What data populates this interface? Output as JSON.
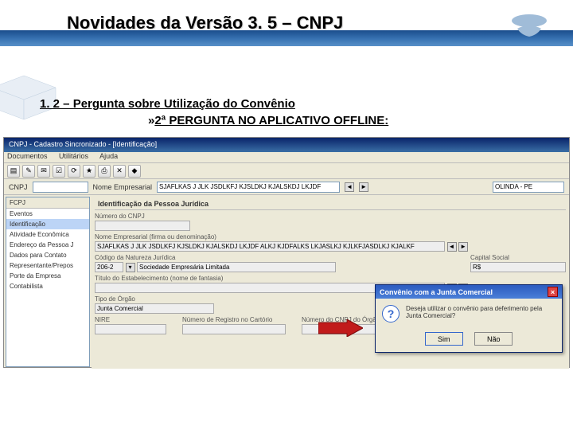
{
  "page": {
    "title": "Novidades da Versão 3. 5 – CNPJ",
    "section_header": "1. 2 – Pergunta sobre Utilização do Convênio",
    "section_sub": "2ª PERGUNTA NO APLICATIVO OFFLINE:"
  },
  "app": {
    "window_title": "CNPJ - Cadastro Sincronizado - [Identificação]",
    "menu": {
      "documentos": "Documentos",
      "utilitarios": "Utilitários",
      "ajuda": "Ajuda"
    },
    "topbar": {
      "cnpj_label": "CNPJ",
      "cnpj_value": "",
      "nome_label": "Nome Empresarial",
      "nome_value": "SJAFLKAS J JLK JSDLKFJ KJSLDKJ KJALSKDJ LKJDF",
      "location_value": "OLINDA - PE"
    },
    "sidebar": {
      "header": "FCPJ",
      "items": [
        "Eventos",
        "Identificação",
        "Atividade Econômica",
        "Endereço da Pessoa J",
        "Dados para Contato",
        "Representante/Prepos",
        "Porte da Empresa",
        "Contabilista"
      ],
      "selected_index": 1
    },
    "form": {
      "panel_title": "Identificação da Pessoa Jurídica",
      "numero_cnpj_label": "Número do CNPJ",
      "numero_cnpj_value": "",
      "nome_emp_label": "Nome Empresarial (firma ou denominação)",
      "nome_emp_value": "SJAFLKAS J JLK JSDLKFJ KJSLDKJ KJALSKDJ LKJDF ALKJ KJDFALKS LKJASLKJ KJLKFJASDLKJ KJALKF",
      "prev_icon": "◄",
      "next_icon": "►",
      "cod_nat_label": "Código da Natureza Jurídica",
      "cod_nat_value": "206-2",
      "cod_nat_desc": "Sociedade Empresária Limitada",
      "capital_label": "Capital Social",
      "capital_value": "R$",
      "titulo_label": "Título do Estabelecimento (nome de fantasia)",
      "titulo_value": "",
      "tipo_orgao_label": "Tipo de Órgão",
      "tipo_orgao_value": "Junta Comercial",
      "nire_label": "NIRE",
      "nire_value": "",
      "num_reg_label": "Número de Registro no Cartório",
      "num_reg_value": "",
      "num_cnpj_orgao_label": "Número do CNPJ do Órgão de Registro",
      "num_cnpj_orgao_value": ""
    }
  },
  "dialog": {
    "title": "Convênio com a Junta Comercial",
    "message": "Deseja utilizar o convênio para deferimento pela Junta Comercial?",
    "yes": "Sim",
    "no": "Não",
    "icon_char": "?"
  }
}
